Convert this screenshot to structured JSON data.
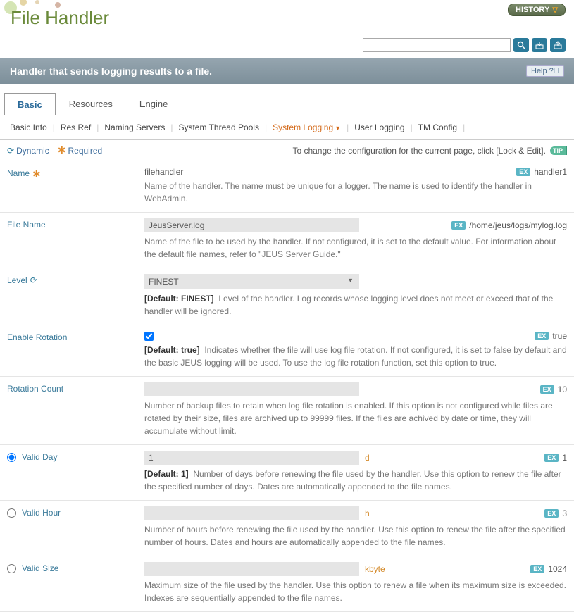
{
  "header": {
    "title": "File Handler",
    "history": "HISTORY"
  },
  "banner": {
    "text": "Handler that sends logging results to a file.",
    "help": "Help"
  },
  "tabs": [
    {
      "label": "Basic",
      "active": true
    },
    {
      "label": "Resources",
      "active": false
    },
    {
      "label": "Engine",
      "active": false
    }
  ],
  "subtabs": {
    "items": [
      "Basic Info",
      "Res Ref",
      "Naming Servers",
      "System Thread Pools",
      "System Logging",
      "User Logging",
      "TM Config"
    ],
    "active": "System Logging"
  },
  "legend": {
    "dynamic": "Dynamic",
    "required": "Required",
    "note": "To change the configuration for the current page, click [Lock & Edit].",
    "tip": "TIP"
  },
  "fields": {
    "name": {
      "label": "Name",
      "value": "filehandler",
      "ex": "handler1",
      "desc": "Name of the handler. The name must be unique for a logger. The name is used to identify the handler in WebAdmin."
    },
    "filename": {
      "label": "File Name",
      "value": "JeusServer.log",
      "ex": "/home/jeus/logs/mylog.log",
      "desc": "Name of the file to be used by the handler. If not configured, it is set to the default value. For information about the default file names, refer to \"JEUS Server Guide.\""
    },
    "level": {
      "label": "Level",
      "value": "FINEST",
      "default": "[Default: FINEST]",
      "desc": "Level of the handler. Log records whose logging level does not meet or exceed that of the handler will be ignored."
    },
    "enableRotation": {
      "label": "Enable Rotation",
      "checked": true,
      "ex": "true",
      "default": "[Default: true]",
      "desc": "Indicates whether the file will use log file rotation. If not configured, it is set to false by default and the basic JEUS logging will be used. To use the log file rotation function, set this option to true."
    },
    "rotationCount": {
      "label": "Rotation Count",
      "value": "",
      "ex": "10",
      "desc": "Number of backup files to retain when log file rotation is enabled. If this option is not configured while files are rotated by their size, files are archived up to 99999 files. If the files are achived by date or time, they will accumulate without limit."
    },
    "validDay": {
      "label": "Valid Day",
      "value": "1",
      "unit": "d",
      "ex": "1",
      "default": "[Default: 1]",
      "desc": "Number of days before renewing the file used by the handler. Use this option to renew the file after the specified number of days. Dates are automatically appended to the file names."
    },
    "validHour": {
      "label": "Valid Hour",
      "value": "",
      "unit": "h",
      "ex": "3",
      "desc": "Number of hours before renewing the file used by the handler. Use this option to renew the file after the specified number of hours. Dates and hours are automatically appended to the file names."
    },
    "validSize": {
      "label": "Valid Size",
      "value": "",
      "unit": "kbyte",
      "ex": "1024",
      "desc": "Maximum size of the file used by the handler. Use this option to renew a file when its maximum size is exceeded. Indexes are sequentially appended to the file names."
    }
  },
  "exLabel": "EX"
}
